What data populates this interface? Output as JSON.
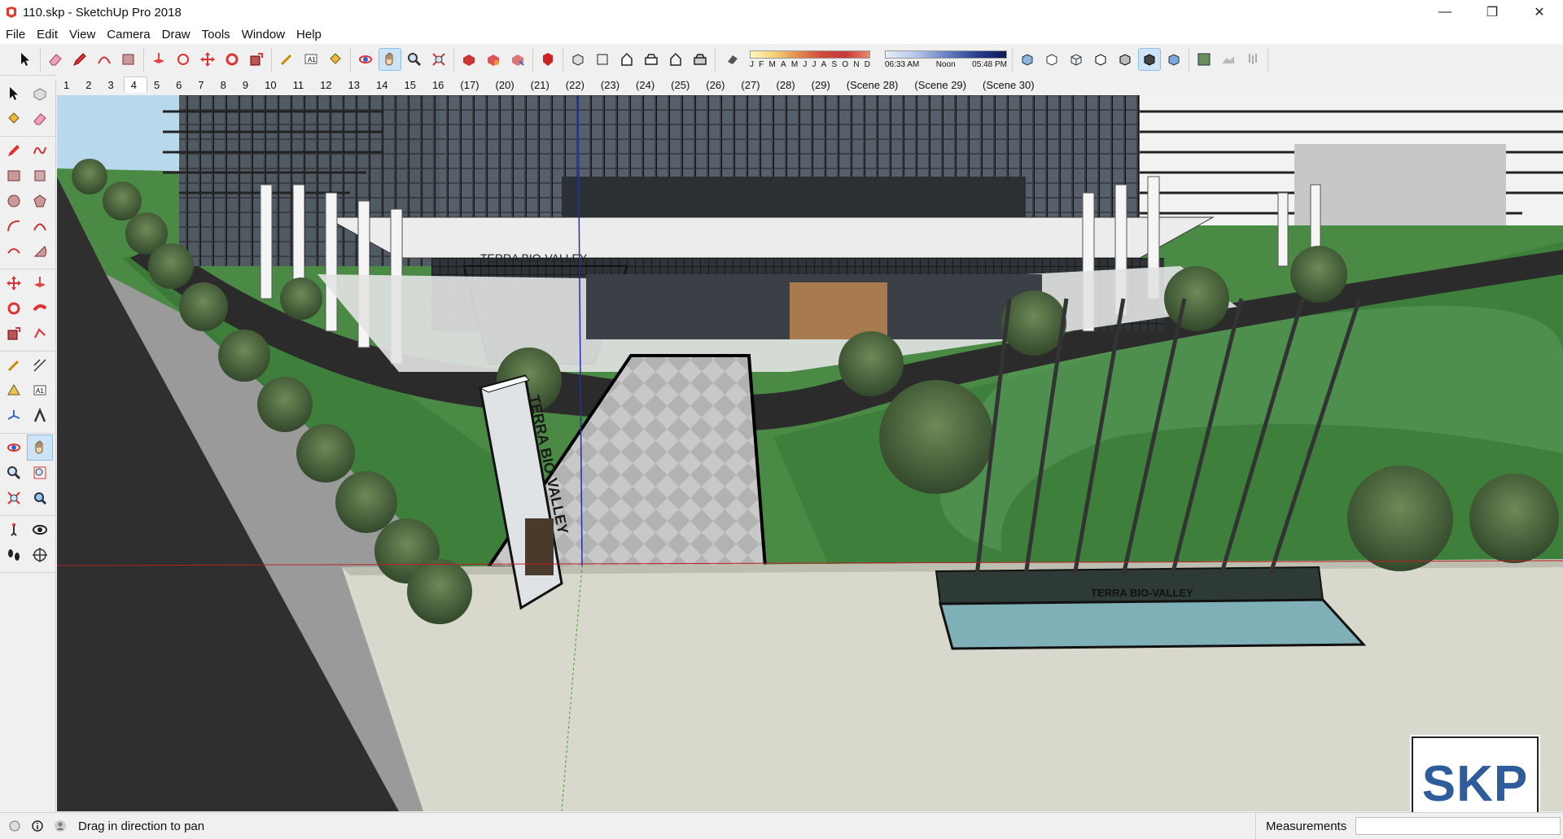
{
  "window": {
    "title": "110.skp - SketchUp Pro 2018",
    "controls": {
      "minimize": "—",
      "maximize": "❐",
      "close": "✕"
    }
  },
  "menu": [
    "File",
    "Edit",
    "View",
    "Camera",
    "Draw",
    "Tools",
    "Window",
    "Help"
  ],
  "shadows": {
    "months": [
      "J",
      "F",
      "M",
      "A",
      "M",
      "J",
      "J",
      "A",
      "S",
      "O",
      "N",
      "D"
    ],
    "time_start": "06:33 AM",
    "time_mid": "Noon",
    "time_end": "05:48 PM"
  },
  "scenes": {
    "active_index": 3,
    "tabs": [
      "1",
      "2",
      "3",
      "4",
      "5",
      "6",
      "7",
      "8",
      "9",
      "10",
      "11",
      "12",
      "13",
      "14",
      "15",
      "16",
      "(17)",
      "(20)",
      "(21)",
      "(22)",
      "(23)",
      "(24)",
      "(25)",
      "(26)",
      "(27)",
      "(28)",
      "(29)",
      "(Scene 28)",
      "(Scene 29)",
      "(Scene 30)"
    ]
  },
  "model": {
    "canopy_sign": "TERRA BIO-VALLEY",
    "totem_sign": "TERRA BIO-VALLEY",
    "fountain_sign": "TERRA BIO-VALLEY"
  },
  "status": {
    "message": "Drag in direction to pan",
    "measurements_label": "Measurements",
    "measurements_value": ""
  },
  "watermark": "SKP",
  "colors": {
    "grass": "#3f7f3c",
    "sky": "#b8d9ec",
    "accent_active": "#cde4f7"
  }
}
